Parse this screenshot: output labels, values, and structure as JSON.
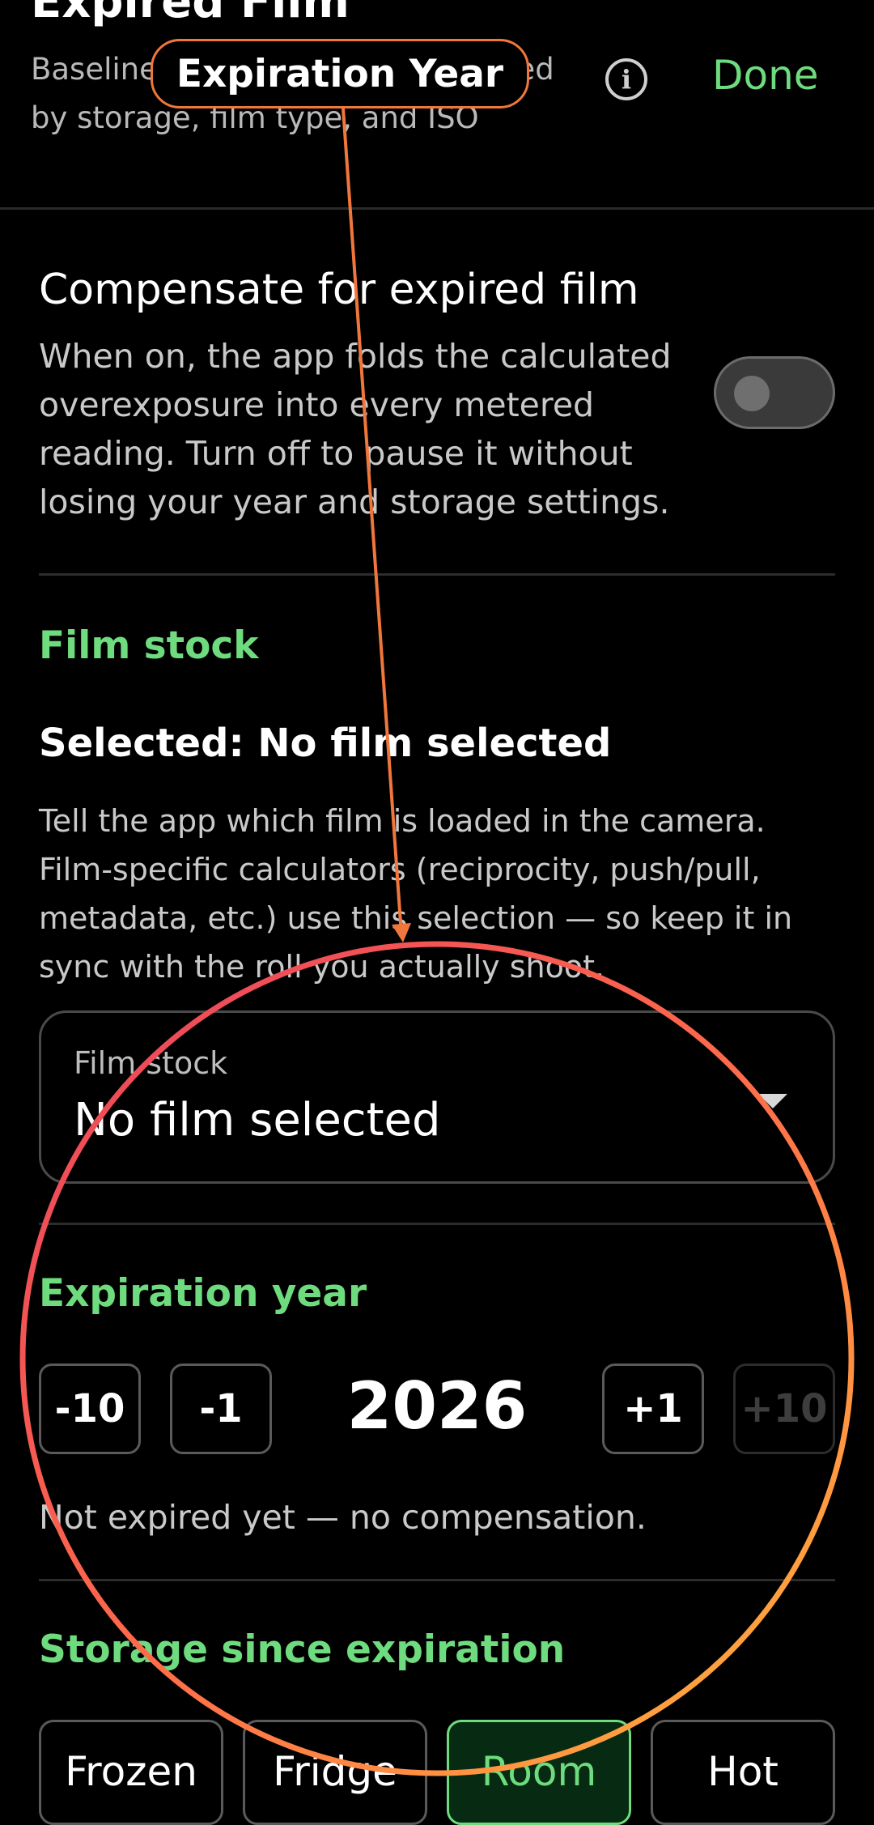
{
  "header": {
    "title": "Expired Film",
    "subtitle": "Baseline 1 stop per decade, scaled by storage, film type, and ISO",
    "info_icon": "info-icon",
    "done_label": "Done"
  },
  "compensate": {
    "title": "Compensate for expired film",
    "description": "When on, the app folds the calculated overexposure into every metered reading. Turn off to pause it without losing your year and storage settings.",
    "toggle_on": false
  },
  "film_stock": {
    "heading": "Film stock",
    "selected_line": "Selected: No film selected",
    "description": "Tell the app which film is loaded in the camera. Film-specific calculators (reciprocity, push/pull, metadata, etc.) use this selection — so keep it in sync with the roll you actually shoot.",
    "dropdown_label": "Film stock",
    "dropdown_value": "No film selected"
  },
  "expiration": {
    "heading": "Expiration year",
    "buttons": [
      "-10",
      "-1",
      "+1",
      "+10"
    ],
    "year": "2026",
    "status": "Not expired yet — no compensation."
  },
  "storage": {
    "heading": "Storage since expiration",
    "options": [
      "Frozen",
      "Fridge",
      "Room",
      "Hot"
    ],
    "selected": "Room"
  },
  "annotation": {
    "label": "Expiration Year",
    "colors": {
      "callout_border": "#f0773b",
      "arrow": "#f0773b",
      "ring_start": "#e8405e",
      "ring_end": "#ffb63a"
    }
  },
  "colors": {
    "accent": "#6edc7e",
    "background": "#000000"
  }
}
